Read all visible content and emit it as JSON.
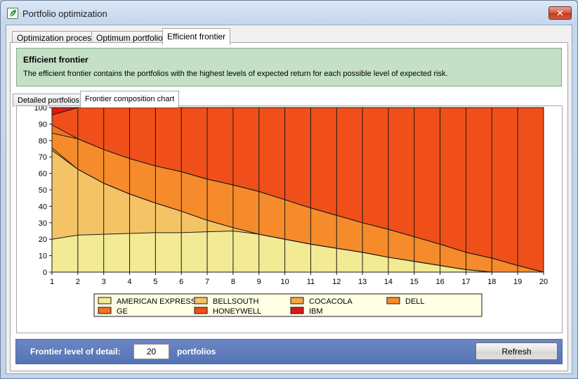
{
  "window": {
    "title": "Portfolio optimization",
    "close_glyph": "✕"
  },
  "tabs": [
    {
      "label": "Optimization process",
      "active": false
    },
    {
      "label": "Optimum portfolios",
      "active": false
    },
    {
      "label": "Efficient frontier",
      "active": true
    }
  ],
  "info": {
    "title": "Efficient frontier",
    "description": "The efficient frontier contains the portfolios with the highest levels of expected return for each possible level of expected risk."
  },
  "sub_tabs": [
    {
      "label": "Detailed portfolios",
      "active": false
    },
    {
      "label": "Frontier composition chart",
      "active": true
    }
  ],
  "footer": {
    "label": "Frontier level of detail:",
    "value": "20",
    "unit": "portfolios",
    "refresh_label": "Refresh"
  },
  "icons": {
    "app": "leaf-icon",
    "close": "close-icon"
  },
  "chart_data": {
    "type": "area",
    "stacked": true,
    "x": [
      1,
      2,
      3,
      4,
      5,
      6,
      7,
      8,
      9,
      10,
      11,
      12,
      13,
      14,
      15,
      16,
      17,
      18,
      19,
      20
    ],
    "ylim": [
      0,
      100
    ],
    "xlim": [
      1,
      20
    ],
    "yticks": [
      0,
      10,
      20,
      30,
      40,
      50,
      60,
      70,
      80,
      90,
      100
    ],
    "grid": "vertical lines at each x",
    "legend_position": "bottom",
    "series": [
      {
        "name": "AMERICAN EXPRESS",
        "color": "#f3ea95",
        "values": [
          20,
          22.5,
          23,
          23.5,
          24,
          24,
          24.5,
          25,
          23,
          20,
          17,
          14.5,
          12,
          9,
          6.5,
          4,
          1.5,
          0,
          0,
          0
        ]
      },
      {
        "name": "BELLSOUTH",
        "color": "#f4c365",
        "values": [
          54,
          40,
          31,
          24,
          18,
          13,
          7,
          2,
          0,
          0,
          0,
          0,
          0,
          0,
          0,
          0,
          0,
          0,
          0,
          0
        ]
      },
      {
        "name": "COCACOLA",
        "color": "#f7a645",
        "values": [
          1.5,
          0,
          0,
          0,
          0,
          0,
          0,
          0,
          0,
          0,
          0,
          0,
          0,
          0,
          0,
          0,
          0,
          0,
          0,
          0
        ]
      },
      {
        "name": "DELL",
        "color": "#f58b2a",
        "values": [
          9,
          18.5,
          20.5,
          21.5,
          22.5,
          24,
          25,
          26,
          26,
          24,
          22,
          20,
          18,
          17,
          15,
          13,
          10.5,
          8.5,
          4,
          0
        ]
      },
      {
        "name": "GE",
        "color": "#f07328",
        "values": [
          5,
          0,
          0,
          0,
          0,
          0,
          0,
          0,
          0,
          0,
          0,
          0,
          0,
          0,
          0,
          0,
          0,
          0,
          0,
          0
        ]
      },
      {
        "name": "HONEYWELL",
        "color": "#f04f19",
        "values": [
          6,
          19,
          25.5,
          31,
          35.5,
          39,
          43.5,
          47,
          51,
          56,
          61,
          65.5,
          70,
          74,
          78.5,
          83,
          88,
          91.5,
          96,
          100
        ]
      },
      {
        "name": "IBM",
        "color": "#dd1a14",
        "values": [
          4.5,
          0,
          0,
          0,
          0,
          0,
          0,
          0,
          0,
          0,
          0,
          0,
          0,
          0,
          0,
          0,
          0,
          0,
          0,
          0
        ]
      }
    ]
  }
}
